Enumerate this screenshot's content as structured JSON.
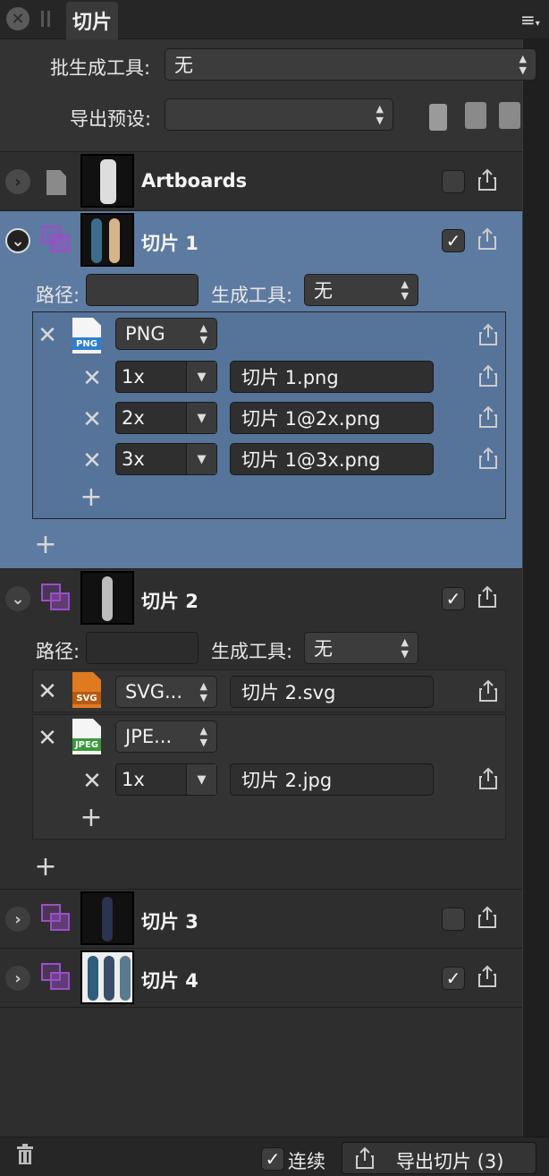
{
  "window": {
    "tab_title": "切片"
  },
  "settings": {
    "macro_label": "批生成工具:",
    "macro_value": "无",
    "preset_label": "导出预设:",
    "preset_value": ""
  },
  "rows": {
    "artboards": {
      "title": "Artboards",
      "checked": false
    },
    "slice1": {
      "title": "切片 1",
      "checked": true,
      "path_label": "路径:",
      "path_value": "",
      "macro_label": "生成工具:",
      "macro_value": "无",
      "format": "PNG",
      "sizes": [
        {
          "scale": "1x",
          "filename": "切片 1.png"
        },
        {
          "scale": "2x",
          "filename": "切片 1@2x.png"
        },
        {
          "scale": "3x",
          "filename": "切片 1@3x.png"
        }
      ]
    },
    "slice2": {
      "title": "切片 2",
      "checked": true,
      "path_label": "路径:",
      "path_value": "",
      "macro_label": "生成工具:",
      "macro_value": "无",
      "svg_format": "SVG...",
      "svg_filename": "切片 2.svg",
      "svg_tag": "SVG",
      "jpeg_format": "JPE...",
      "jpeg_tag": "JPEG",
      "jpeg_sizes": [
        {
          "scale": "1x",
          "filename": "切片 2.jpg"
        }
      ]
    },
    "slice3": {
      "title": "切片 3",
      "checked": false
    },
    "slice4": {
      "title": "切片 4",
      "checked": true
    }
  },
  "png_tag": "PNG",
  "bottom": {
    "continuous_label": "连续",
    "continuous_checked": true,
    "export_label": "导出切片 (3)"
  },
  "icons": {
    "close": "close-icon",
    "menu": "hamburger-menu-icon",
    "copy": "copy-icon",
    "paste": "paste-icon",
    "add_preset": "add-preset-icon",
    "share": "export-share-icon",
    "trash": "trash-icon"
  },
  "colors": {
    "selected_row": "#5d7ba1",
    "slice_icon": "#9b4fc7",
    "svg_tag": "#e07a20",
    "png_tag": "#2f7fd1",
    "jpeg_tag": "#3a9a3a"
  }
}
